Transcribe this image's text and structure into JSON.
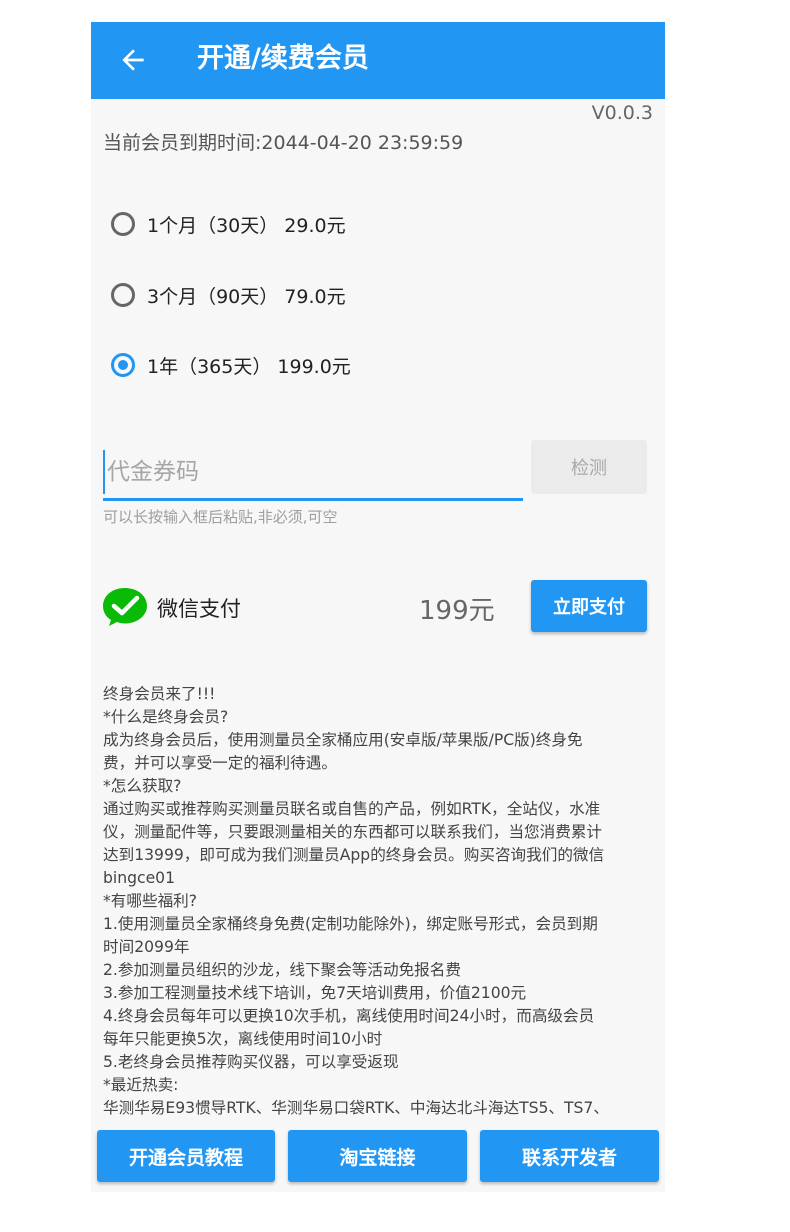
{
  "app_bar": {
    "back_icon": "arrow-left-icon",
    "title": "开通/续费会员",
    "color": "#2196f3"
  },
  "version": "V0.0.3",
  "expiry": "当前会员到期时间:2044-04-20 23:59:59",
  "plans": [
    {
      "label": "1个月（30天） 29.0元",
      "selected": false
    },
    {
      "label": "3个月（90天） 79.0元",
      "selected": false
    },
    {
      "label": "1年（365天） 199.0元",
      "selected": true
    }
  ],
  "coupon": {
    "placeholder": "代金券码",
    "value": "",
    "check_label": "检测",
    "hint": "可以长按输入框后粘贴,非必须,可空"
  },
  "payment": {
    "method_icon": "wechat-pay-icon",
    "method_label": "微信支付",
    "amount": "199元",
    "pay_label": "立即支付"
  },
  "description": [
    "终身会员来了!!!",
    "*什么是终身会员?",
    "成为终身会员后，使用测量员全家桶应用(安卓版/苹果版/PC版)终身免",
    "费，并可以享受一定的福利待遇。",
    "*怎么获取?",
    "通过购买或推荐购买测量员联名或自售的产品，例如RTK，全站仪，水准",
    "仪，测量配件等，只要跟测量相关的东西都可以联系我们，当您消费累计",
    "达到13999，即可成为我们测量员App的终身会员。购买咨询我们的微信",
    "bingce01",
    "*有哪些福利?",
    "1.使用测量员全家桶终身免费(定制功能除外)，绑定账号形式，会员到期",
    "时间2099年",
    "2.参加测量员组织的沙龙，线下聚会等活动免报名费",
    "3.参加工程测量技术线下培训，免7天培训费用，价值2100元",
    "4.终身会员每年可以更换10次手机，离线使用时间24小时，而高级会员",
    "每年只能更换5次，离线使用时间10小时",
    "5.老终身会员推荐购买仪器，可以享受返现",
    "*最近热卖:",
    "华测华易E93惯导RTK、华测华易口袋RTK、中海达北斗海达TS5、TS7、"
  ],
  "bottom_buttons": {
    "tutorial": "开通会员教程",
    "taobao": "淘宝链接",
    "contact": "联系开发者"
  }
}
